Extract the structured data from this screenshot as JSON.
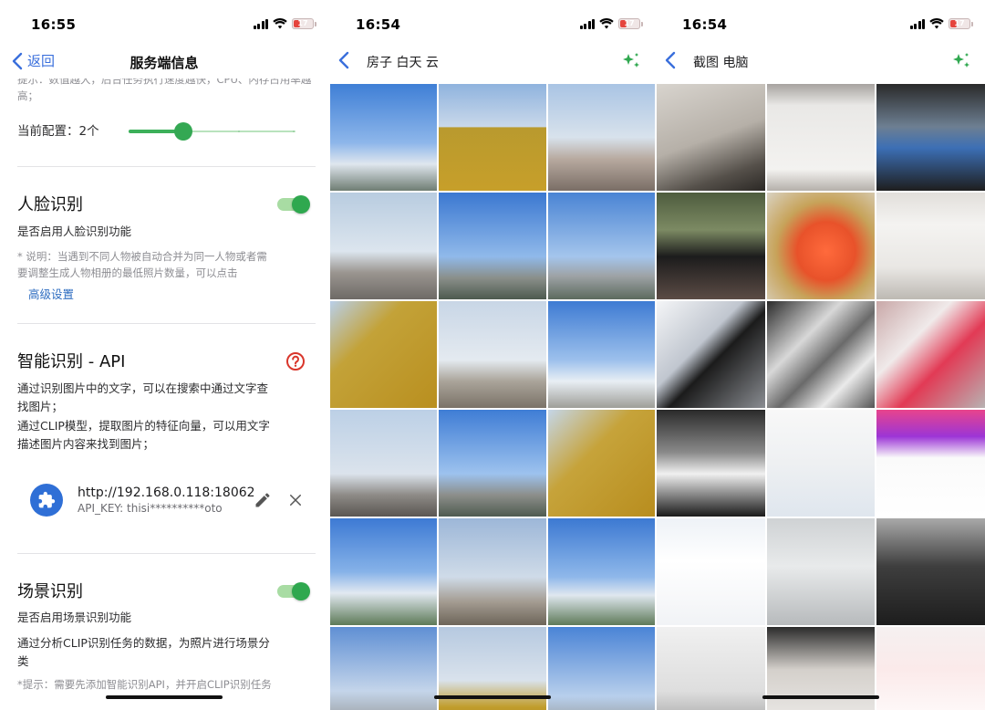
{
  "screens": {
    "settings": {
      "status_time": "16:55",
      "battery": "17",
      "back_label": "返回",
      "title": "服务端信息",
      "top_hint": "提示：数值越大，后台任务执行速度越快，CPU、内存占用率越高；",
      "current_config_label": "当前配置：2个",
      "slider_level_fraction": 0.33,
      "face": {
        "title": "人脸识别",
        "enable_label": "是否启用人脸识别功能",
        "note": "* 说明：当遇到不同人物被自动合并为同一人物或者需要调整生成人物相册的最低照片数量，可以点击",
        "advanced_link": "高级设置",
        "enabled": true
      },
      "smart_api": {
        "title": "智能识别 - API",
        "desc1": "通过识别图片中的文字，可以在搜索中通过文字查找图片；",
        "desc2": "通过CLIP模型，提取图片的特征向量，可以用文字描述图片内容来找到图片；",
        "server_url": "http://192.168.0.118:18062",
        "api_key": "API_KEY: thisi**********oto"
      },
      "scene": {
        "title": "场景识别",
        "enable_label": "是否启用场景识别功能",
        "desc": "通过分析CLIP识别任务的数据，为照片进行场景分类",
        "hint": "*提示：需要先添加智能识别API，并开启CLIP识别任务",
        "enabled": true
      }
    },
    "search_sky": {
      "status_time": "16:54",
      "battery": "17",
      "query": "房子 白天 云"
    },
    "search_pc": {
      "status_time": "16:54",
      "battery": "17",
      "query": "截图 电脑"
    }
  },
  "colors": {
    "accent_blue": "#3a6fdc",
    "toggle_green": "#2fa84f",
    "help_red": "#d9362b"
  },
  "icons": {
    "back": "chevron-left-icon",
    "sparkle": "sparkle-icon",
    "help": "question-circle-icon",
    "plugin": "puzzle-icon",
    "edit": "pencil-icon",
    "close": "close-icon"
  }
}
